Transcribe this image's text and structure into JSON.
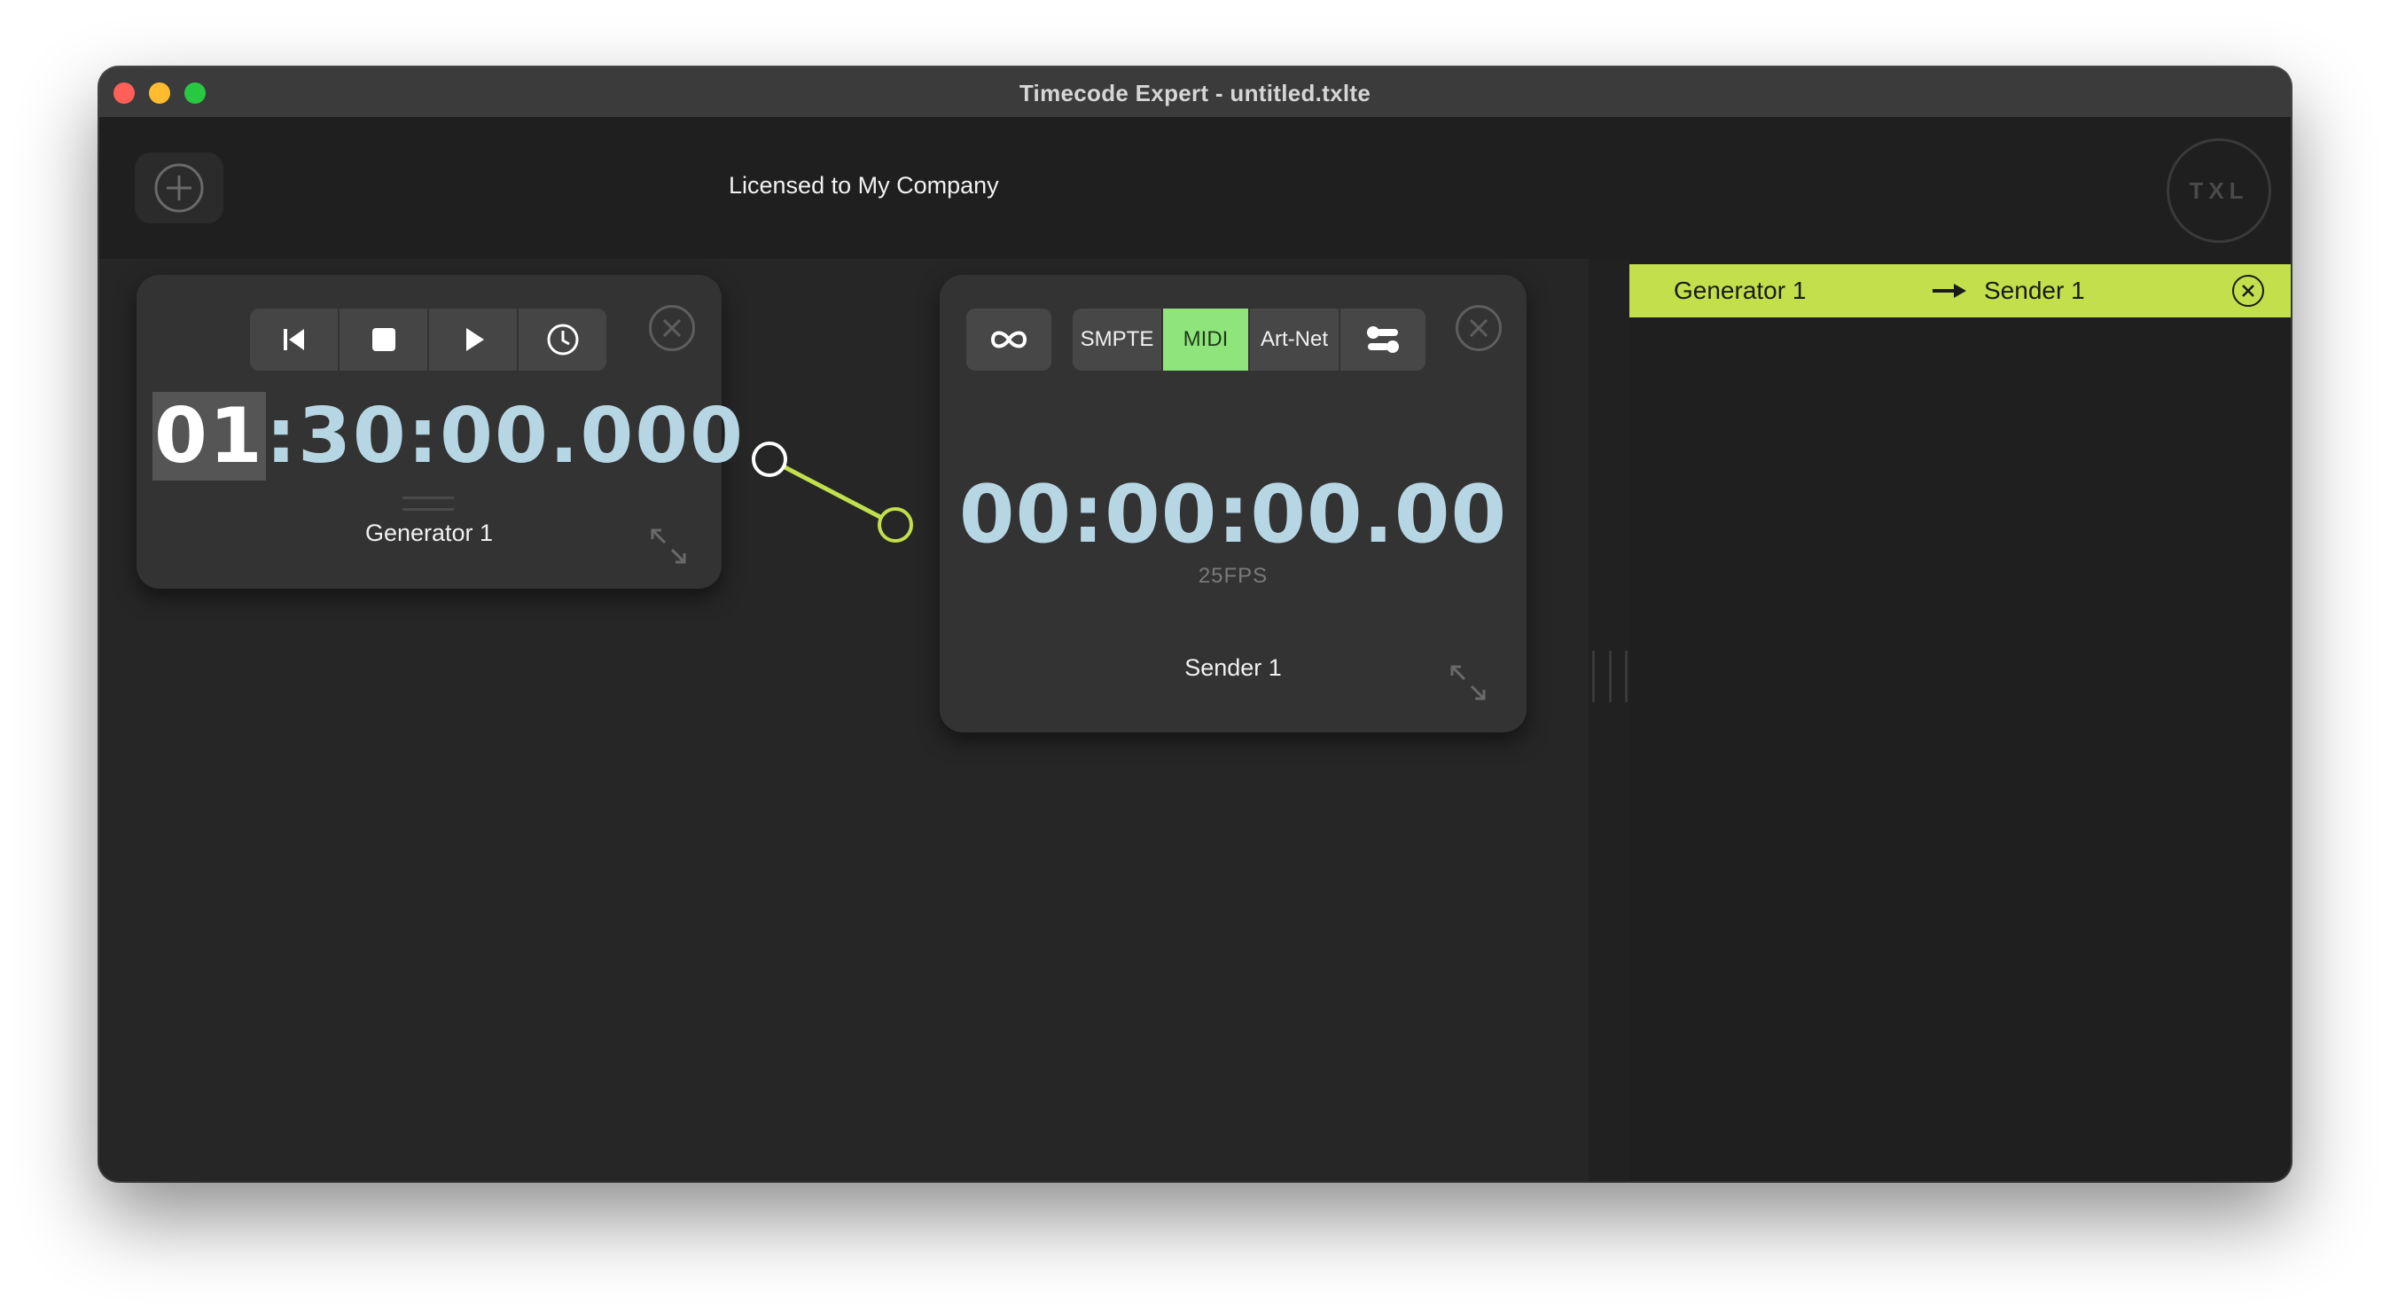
{
  "window": {
    "title": "Timecode Expert - untitled.txlte"
  },
  "header": {
    "license_text": "Licensed to My Company",
    "logo_text": "TXL",
    "add_icon": "plus-circle-icon"
  },
  "generator": {
    "timecode_hours": "01",
    "timecode_rest": ":30:00.000",
    "label": "Generator 1",
    "transport_icons": [
      "skip-back-icon",
      "stop-icon",
      "play-icon",
      "clock-icon"
    ]
  },
  "sender": {
    "timecode": "00:00:00.00",
    "fps": "25FPS",
    "label": "Sender 1",
    "loop_icon": "infinity-icon",
    "protocols": [
      "SMPTE",
      "MIDI",
      "Art-Net"
    ],
    "active_protocol": "MIDI",
    "settings_icon": "sliders-icon"
  },
  "routes": [
    {
      "source": "Generator 1",
      "destination": "Sender 1"
    }
  ],
  "colors": {
    "accent": "#c3df4c",
    "active_protocol": "#90e47c",
    "timecode": "#b7d6e4"
  }
}
